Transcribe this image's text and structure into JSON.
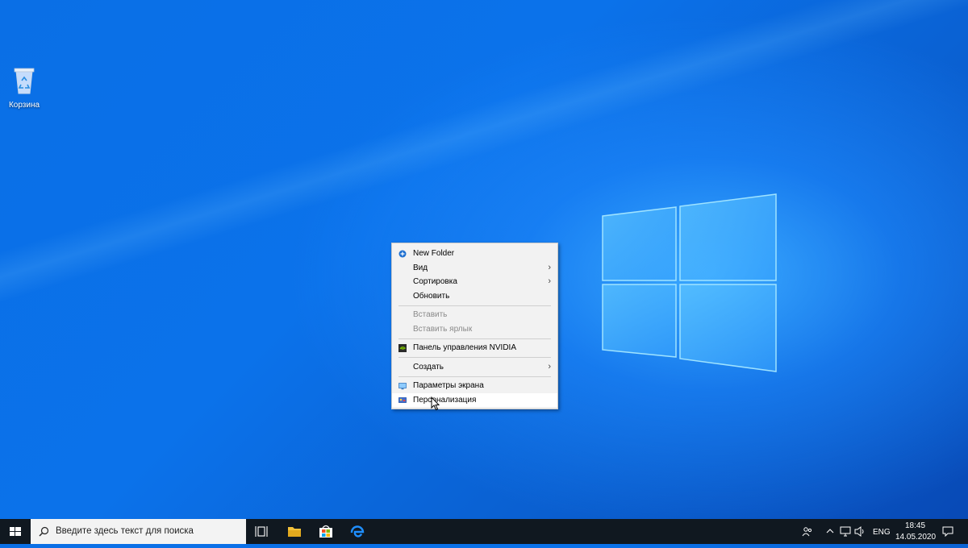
{
  "desktop": {
    "recycle_bin_label": "Корзина"
  },
  "context_menu": {
    "items": [
      {
        "label": "New Folder",
        "icon": "new-folder-icon"
      },
      {
        "label": "Вид",
        "submenu": true
      },
      {
        "label": "Сортировка",
        "submenu": true
      },
      {
        "label": "Обновить"
      },
      {
        "label": "Вставить",
        "disabled": true
      },
      {
        "label": "Вставить ярлык",
        "disabled": true
      },
      {
        "label": "Панель управления NVIDIA",
        "icon": "nvidia-icon"
      },
      {
        "label": "Создать",
        "submenu": true
      },
      {
        "label": "Параметры экрана",
        "icon": "display-settings-icon"
      },
      {
        "label": "Персонализация",
        "icon": "personalization-icon",
        "hovered": true
      }
    ]
  },
  "taskbar": {
    "search_placeholder": "Введите здесь текст для поиска",
    "language": "ENG",
    "time": "18:45",
    "date": "14.05.2020",
    "pinned": [
      "task-view-icon",
      "file-explorer-icon",
      "store-icon",
      "edge-icon"
    ]
  },
  "colors": {
    "desktop_blue": "#0a6fe6",
    "taskbar": "#101820",
    "menu_bg": "#f2f2f2"
  }
}
